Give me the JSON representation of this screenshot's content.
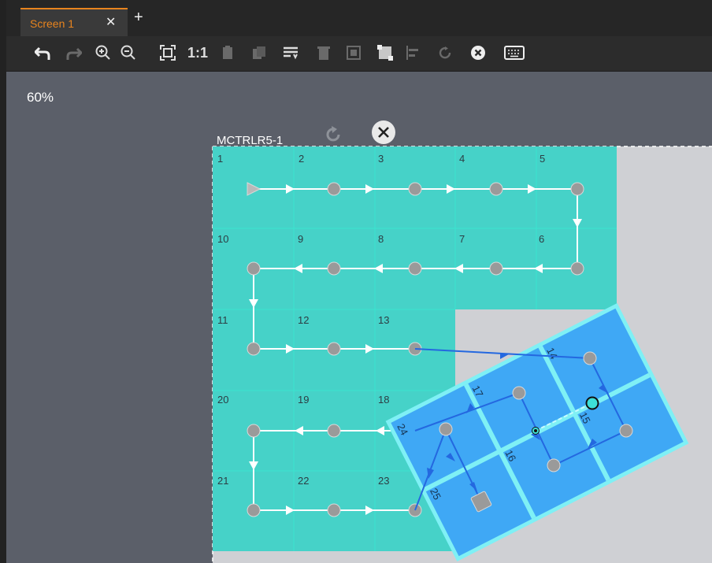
{
  "tab": {
    "label": "Screen 1",
    "close": "✕",
    "add": "+"
  },
  "toolbar": {
    "actual_size_label": "1:1"
  },
  "zoom": "60%",
  "controller": {
    "name": "MCTRLR5-1"
  },
  "tiles": [
    "1",
    "2",
    "3",
    "4",
    "5",
    "10",
    "9",
    "8",
    "7",
    "6",
    "11",
    "12",
    "13",
    "20",
    "19",
    "18",
    "21",
    "22",
    "23"
  ],
  "rotated_tiles": [
    "14",
    "17",
    "24",
    "15",
    "16",
    "25"
  ],
  "colors": {
    "tab_accent": "#e8841e",
    "cabinet": "#46d2c8",
    "rotated": "#3fa8f5",
    "wiring_blue": "#2468e0"
  }
}
